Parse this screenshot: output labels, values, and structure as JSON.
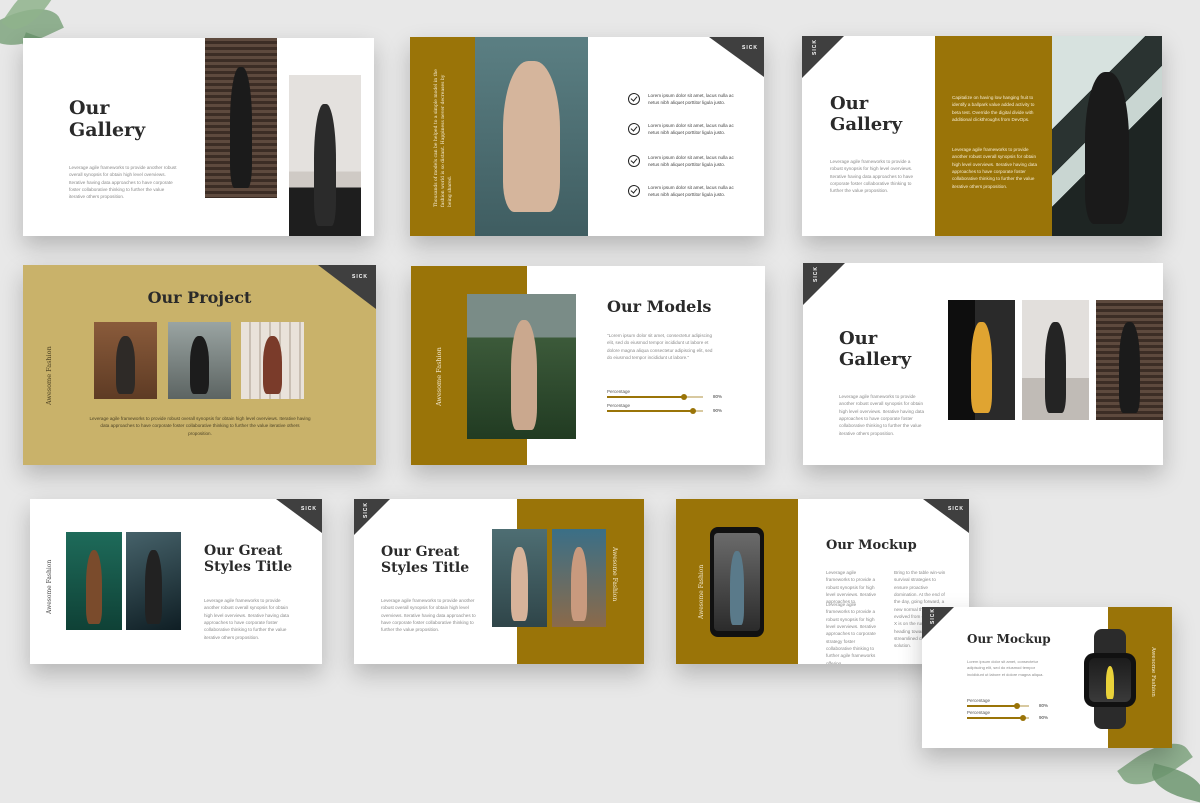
{
  "brand_mark": "SICK",
  "colors": {
    "gold": "#9a7408",
    "khaki": "#c9b26a",
    "dark": "#3f3f3f",
    "background": "#e8e8e8"
  },
  "slides": {
    "gallery1": {
      "title": "Our\nGallery",
      "body": "Leverage agile frameworks to provide another robust overall synopsis for obtain high level overviews. Iterative having data approaches to have corporate foster collaborative thinking to further the value iterative others proposition."
    },
    "checklist": {
      "vertical_quote": "Thousands of models can be helped to a simple model in the fashion world is so distant. Happiness never decreases by being shared.",
      "items": [
        "Lorem ipsum dolor sit amet, lacus nulla ac netus nibh aliquet porttitor ligula justo.",
        "Lorem ipsum dolor sit amet, lacus nulla ac netus nibh aliquet porttitor ligula justo.",
        "Lorem ipsum dolor sit amet, lacus nulla ac netus nibh aliquet porttitor ligula justo.",
        "Lorem ipsum dolor sit amet, lacus nulla ac netus nibh aliquet porttitor ligula justo."
      ]
    },
    "gallery2": {
      "title": "Our\nGallery",
      "body": "Leverage agile frameworks to provide a robust synopsis for high level overviews. Iterative having data approaches to have corporate foster collaborative thinking to further the value proposition.",
      "gold_text1": "Capitalize on having low hanging fruit to identify a ballpark value added activity to beta test. Override the digital divide with additional clickthroughs from DevOps.",
      "gold_text2": "Leverage agile frameworks to provide another robust overall synopsis for obtain high level overviews. Iterative having data approaches to have corporate foster collaborative thinking to further the value iterative others proposition."
    },
    "project": {
      "title": "Our Project",
      "vertical": "Awesome Fashion",
      "body": "Leverage agile frameworks to provide robust overall synopsis for obtain high level overviews. Iterative having data approaches to have corporate foster collaborative thinking to further the value iterative others proposition."
    },
    "models": {
      "title": "Our Models",
      "vertical": "Awesome Fashion",
      "quote": "\"Lorem ipsum dolor sit amet, consectetur adipiscing elit, sed do eiusmod tempor incididunt ut labore et dolore magna aliqua consectetur adipiscing elit, sed do eiusmod tempor incididunt ut labore.\"",
      "bars": [
        {
          "label": "Percentage",
          "value": 0.8,
          "display": "80%"
        },
        {
          "label": "Percentage",
          "value": 0.9,
          "display": "90%"
        }
      ]
    },
    "gallery3": {
      "title": "Our\nGallery",
      "body": "Leverage agile frameworks to provide another robust overall synopsis for obtain high level overviews. Iterative having data approaches to have corporate foster collaborative thinking to further the value iterative others proposition."
    },
    "styles1": {
      "title": "Our Great\nStyles Title",
      "vertical": "Awesome Fashion",
      "body": "Leverage agile frameworks to provide another robust overall synopsis for obtain high level overviews. Iterative having data approaches to have corporate foster collaborative thinking to further the value iterative others proposition."
    },
    "styles2": {
      "title": "Our Great\nStyles Title",
      "vertical": "Awesome Fashion",
      "body": "Leverage agile frameworks to provide another robust overall synopsis for obtain high level overviews. Iterative having data approaches to have corporate foster collaborative thinking to further the value proposition."
    },
    "mockup1": {
      "title": "Our Mockup",
      "vertical": "Awesome Fashion",
      "col1a": "Leverage agile frameworks to provide a robust synopsis for high level overviews. Iterative approaches to.",
      "col1b": "Leverage agile frameworks to provide a robust synopsis for high level overviews. Iterative approaches to corporate strategy foster collaborative thinking to further agile frameworks offering.",
      "col2": "Bring to the table win-win survival strategies to ensure proactive domination. At the end of the day, going forward, a new normal that has evolved from generation X is on the runway heading towards a streamlined cloud solution."
    },
    "mockup2": {
      "title": "Our Mockup",
      "vertical": "Awesome Fashion",
      "body": "Lorem ipsum dolor sit amet, consectetur adipiscing elit, sed do eiusmod tempor incididunt ut labore et dolore magna aliqua.",
      "bars": [
        {
          "label": "Percentage",
          "value": 0.8,
          "display": "80%"
        },
        {
          "label": "Percentage",
          "value": 0.9,
          "display": "90%"
        }
      ]
    }
  }
}
